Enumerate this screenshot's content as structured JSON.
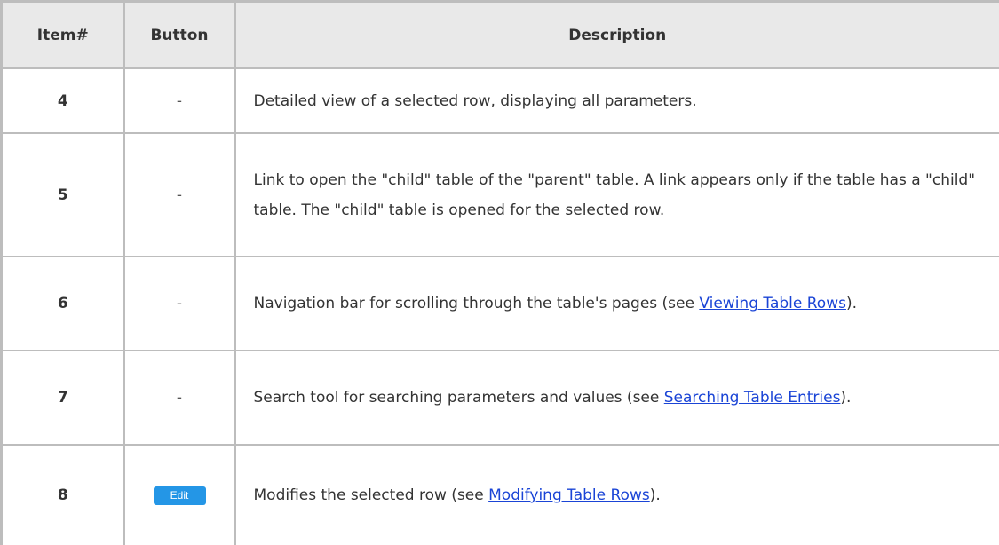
{
  "header": {
    "item": "Item#",
    "button": "Button",
    "description": "Description"
  },
  "rows": [
    {
      "item": "4",
      "button": "-",
      "text_before": "Detailed view of a selected row, displaying all parameters."
    },
    {
      "item": "5",
      "button": "-",
      "text_before": "Link to open the \"child\" table of the \"parent\" table. A link appears only if the table has a \"child\" table. The \"child\" table is opened for the selected row."
    },
    {
      "item": "6",
      "button": "-",
      "text_before": "Navigation bar for scrolling through the table's pages (see ",
      "link": "Viewing Table Rows",
      "text_after": ")."
    },
    {
      "item": "7",
      "button": "-",
      "text_before": "Search tool for searching parameters and values (see ",
      "link": "Searching Table Entries",
      "text_after": ")."
    },
    {
      "item": "8",
      "button": "Edit",
      "text_before": "Modifies the selected row (see ",
      "link": "Modifying Table Rows",
      "text_after": ")."
    }
  ],
  "colors": {
    "header_bg": "#e9e9e9",
    "border": "#bdbdbd",
    "link": "#1a44d6",
    "edit_button_bg": "#2496e6"
  }
}
